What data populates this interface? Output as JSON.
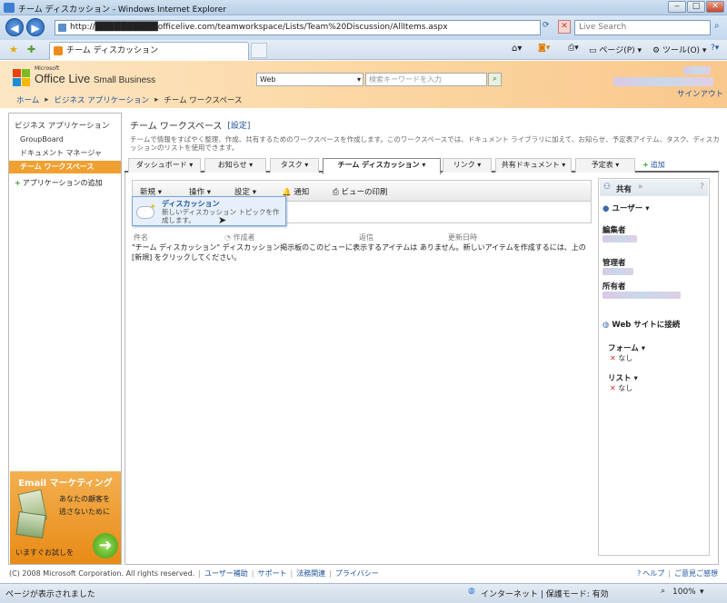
{
  "window": {
    "title": "チーム ディスカッション - Windows Internet Explorer"
  },
  "address": {
    "url": "http://██████████officelive.com/teamworkspace/Lists/Team%20Discussion/AllItems.aspx",
    "search_placeholder": "Live Search"
  },
  "tab": {
    "label": "チーム ディスカッション"
  },
  "ie_tools": {
    "page": "ページ(P)",
    "tools": "ツール(O)"
  },
  "header": {
    "brand_small": "Microsoft",
    "brand": "Office Live",
    "brand_sub": "Small Business",
    "search_scope": "Web",
    "search_placeholder": "検索キーワードを入力",
    "signout": "サインアウト",
    "breadcrumb": [
      "ホーム",
      "ビジネス アプリケーション",
      "チーム ワークスペース"
    ]
  },
  "leftnav": {
    "heading": "ビジネス アプリケーション",
    "items": [
      "GroupBoard",
      "ドキュメント マネージャ",
      "チーム ワークスペース"
    ],
    "add_app": "アプリケーションの追加",
    "promo": {
      "title": "Email マーケティング",
      "line1": "あなたの顧客を",
      "line2": "逃さないために",
      "cta": "いますぐお試しを"
    }
  },
  "page": {
    "title": "チーム ワークスペース",
    "settings_link": "[設定]",
    "description": "チームで情報をすばやく整理、作成、共有するためのワークスペースを作成します。このワークスペースでは、ドキュメント ライブラリに加えて、お知らせ、予定表アイテム、タスク、ディスカッションのリストを使用できます。"
  },
  "tabs": [
    "ダッシュボード",
    "お知らせ",
    "タスク",
    "チーム ディスカッション",
    "リンク",
    "共有ドキュメント",
    "予定表"
  ],
  "add_tab": "追加",
  "toolbar": {
    "new": "新規",
    "actions": "操作",
    "settings": "設定",
    "alert": "通知",
    "print": "ビューの印刷"
  },
  "dropdown": {
    "title": "ディスカッション",
    "desc1": "新しいディスカッション トピックを作",
    "desc2": "成します。"
  },
  "columns": [
    "件名",
    "作成者",
    "返信",
    "更新日時"
  ],
  "empty_message": "\"チーム ディスカッション\" ディスカッション掲示板のこのビューに表示するアイテムは ありません。新しいアイテムを作成するには、上の [新規] をクリックしてください。",
  "right": {
    "share": "共有",
    "users": "ユーザー",
    "editor": "編集者",
    "admin": "管理者",
    "owner": "所有者",
    "connect": "Web サイトに接続",
    "forms": "フォーム",
    "lists": "リスト",
    "none": "なし"
  },
  "footer": {
    "copyright": "(C) 2008 Microsoft Corporation. All rights reserved.",
    "links": [
      "ユーザー補助",
      "サポート",
      "法務関連",
      "プライバシー"
    ],
    "help": "ヘルプ",
    "feedback": "ご意見ご感想"
  },
  "status": {
    "left": "ページが表示されました",
    "zone": "インターネット | 保護モード: 有効",
    "zoom": "100%"
  }
}
